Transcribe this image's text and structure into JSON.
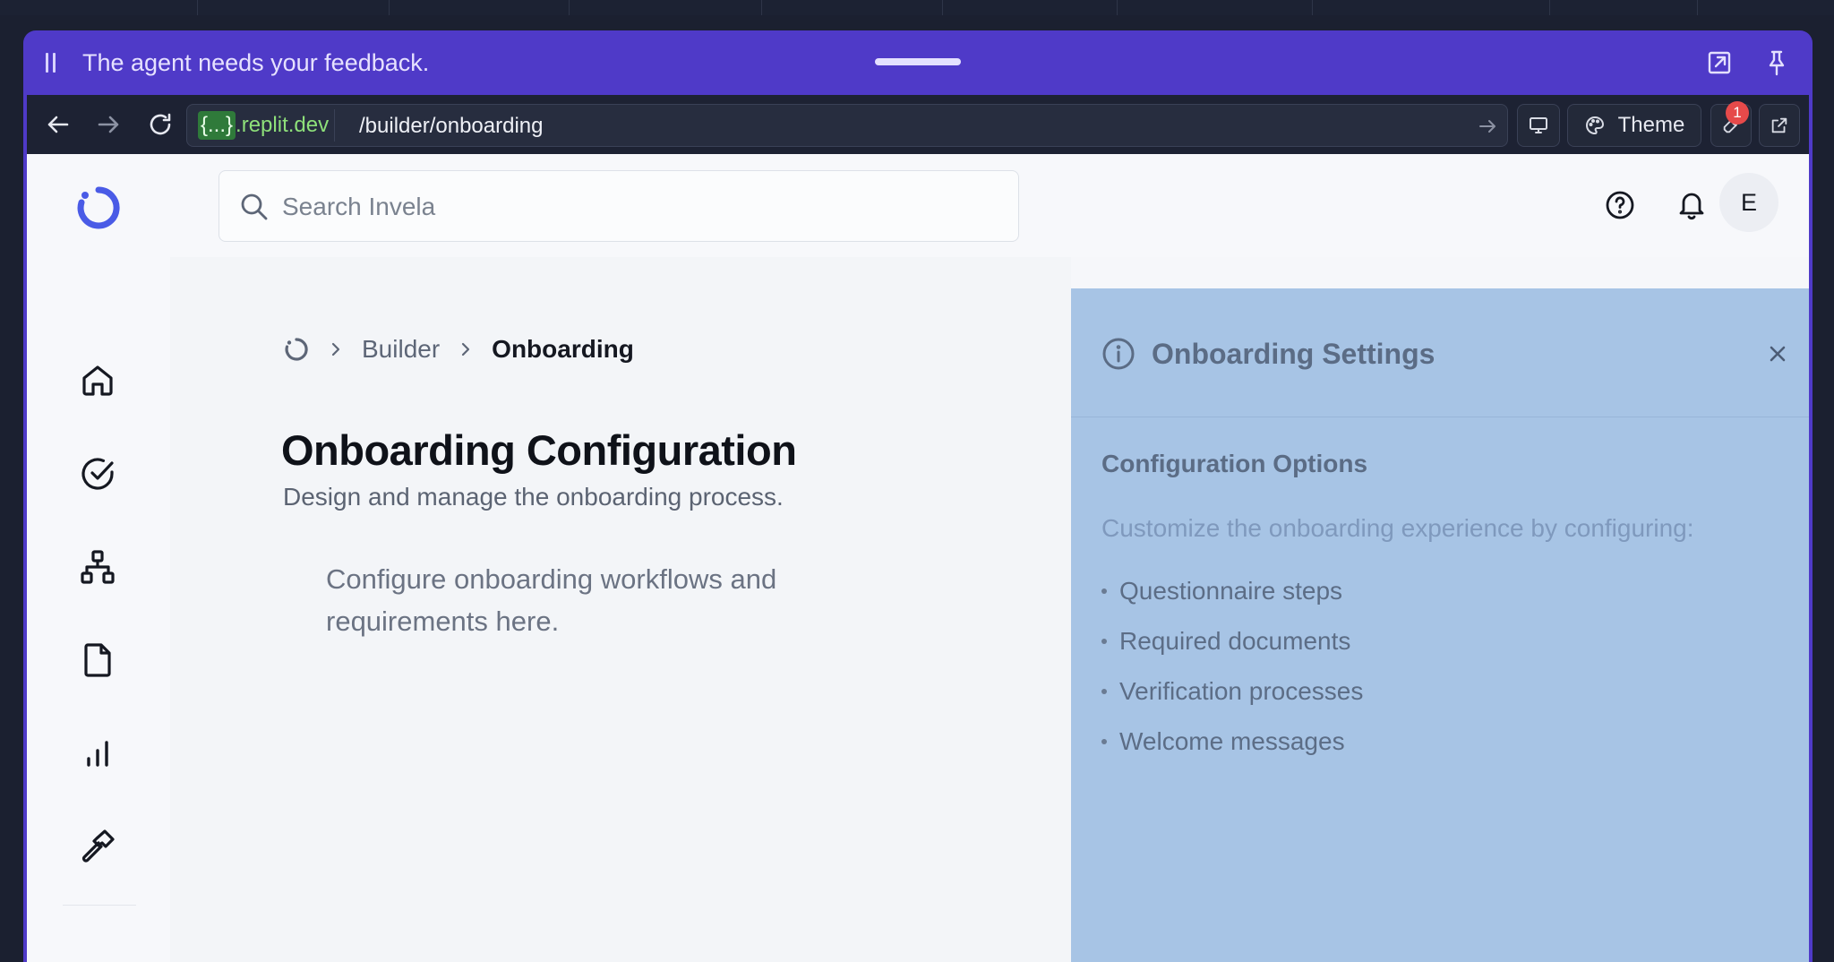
{
  "agent_bar": {
    "message": "The agent needs your feedback."
  },
  "browser": {
    "url_host_brace": "{...}",
    "url_host_domain": ".replit.dev",
    "url_path": "/builder/onboarding",
    "theme_label": "Theme",
    "devtools_badge": "1"
  },
  "app": {
    "search": {
      "placeholder": "Search Invela"
    },
    "user_initial": "E",
    "breadcrumb": {
      "builder": "Builder",
      "current": "Onboarding"
    },
    "page": {
      "title": "Onboarding Configuration",
      "subtitle": "Design and manage the onboarding process.",
      "body": "Configure onboarding workflows and requirements here."
    },
    "sidebar_icons": [
      "home-icon",
      "check-circle-icon",
      "network-icon",
      "file-icon",
      "chart-icon",
      "hammer-icon"
    ]
  },
  "settings_panel": {
    "title": "Onboarding Settings",
    "section_title": "Configuration Options",
    "description": "Customize the onboarding experience by configuring:",
    "items": [
      "Questionnaire steps",
      "Required documents",
      "Verification processes",
      "Welcome messages"
    ]
  },
  "colors": {
    "agent_bar": "#4f3ac8",
    "browser_bar": "#1d2233",
    "panel_bg": "#a7c4e5",
    "brand_blue": "#4a5be6"
  }
}
